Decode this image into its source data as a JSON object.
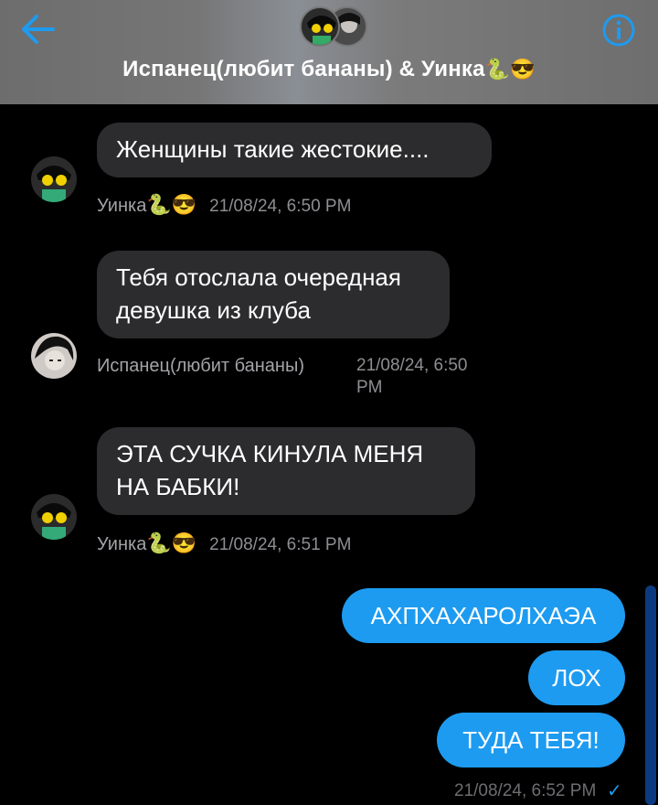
{
  "header": {
    "title": "Испанец(любит бананы)  & Уинка",
    "title_emoji": "🐍😎",
    "back_icon": "arrow-left-icon",
    "info_icon": "info-circle-icon",
    "accent": "#1d9bf0"
  },
  "messages": [
    {
      "text": "Женщины такие жестокие....",
      "sender": "Уинка",
      "sender_emoji": "🐍😎",
      "time": "21/08/24, 6:50 PM"
    },
    {
      "text": "Тебя отослала очередная девушка из клуба",
      "sender": "Испанец(любит бананы)",
      "time_line1": "21/08/24, 6:50",
      "time_line2": "PM"
    },
    {
      "text": "ЭТА СУЧКА КИНУЛА МЕНЯ НА БАБКИ!",
      "sender": "Уинка",
      "sender_emoji": "🐍😎",
      "time": "21/08/24, 6:51 PM"
    }
  ],
  "outgoing": [
    {
      "text": "АХПХАХАРОЛХАЭА"
    },
    {
      "text": "ЛОХ"
    },
    {
      "text": "ТУДА ТЕБЯ!"
    }
  ],
  "outgoing_time": "21/08/24, 6:52 PM",
  "read_mark": "✓"
}
